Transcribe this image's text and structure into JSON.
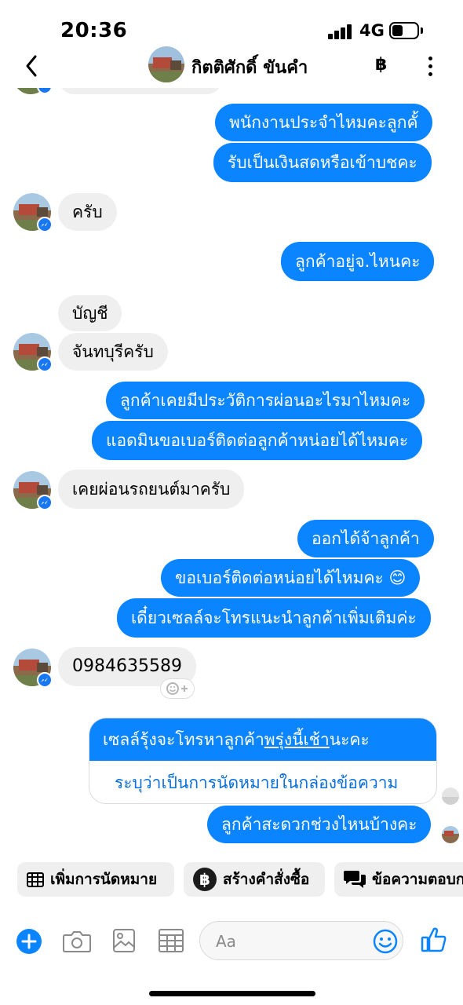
{
  "status_bar": {
    "time": "20:36",
    "network": "4G"
  },
  "header": {
    "contact_name": "กิตติศักดิ์ ขันคำ",
    "payment_icon": "฿"
  },
  "messages": [
    {
      "side": "out",
      "text": "พนักงานประจำไหมคะลูกคั้"
    },
    {
      "side": "out",
      "text": "รับเป็นเงินสดหรือเข้าบชคะ"
    },
    {
      "side": "in",
      "text": "ครับ"
    },
    {
      "side": "out",
      "text": "ลูกค้าอยู่จ.ไหนคะ"
    },
    {
      "side": "in",
      "text": "บัญชี"
    },
    {
      "side": "in",
      "text": "จันทบุรีครับ"
    },
    {
      "side": "out",
      "text": "ลูกค้าเคยมีประวัติการผ่อนอะไรมาไหมคะ"
    },
    {
      "side": "out",
      "text": "แอดมินขอเบอร์ติดต่อลูกค้าหน่อยได้ไหมคะ"
    },
    {
      "side": "in",
      "text": "เคยผ่อนรถยนต์มาครับ"
    },
    {
      "side": "out",
      "text": "ออกได้จ้าลูกค้า"
    },
    {
      "side": "out",
      "text": "ขอเบอร์ติดต่อหน่อยได้ไหมคะ 😊"
    },
    {
      "side": "out",
      "text": "เดี๋ยวเซลล์จะโทรแนะนำลูกค้าเพิ่มเติมค่ะ"
    },
    {
      "side": "in",
      "text": "0984635589"
    },
    {
      "side": "out",
      "text": "ลูกค้าสะดวกช่วงไหนบ้างคะ"
    }
  ],
  "rich_card": {
    "text_before": "เซลล์รุ้งจะโทรหาลูกค้า",
    "text_underlined": "พรุ่งนี้เช้า",
    "text_after": "นะคะ",
    "action_text": "ระบุว่าเป็นการนัดหมายในกล่องข้อความ"
  },
  "quick_actions": [
    {
      "label": "เพิ่มการนัดหมาย",
      "icon": "calendar-icon"
    },
    {
      "label": "สร้างคำสั่งซื้อ",
      "icon": "baht-icon"
    },
    {
      "label": "ข้อความตอบกลับ",
      "icon": "saved-replies-icon"
    }
  ],
  "composer": {
    "placeholder": "Aa"
  },
  "colors": {
    "accent": "#0a84ff",
    "incoming_bubble": "#efefef",
    "messenger_badge": "#1877f2"
  }
}
